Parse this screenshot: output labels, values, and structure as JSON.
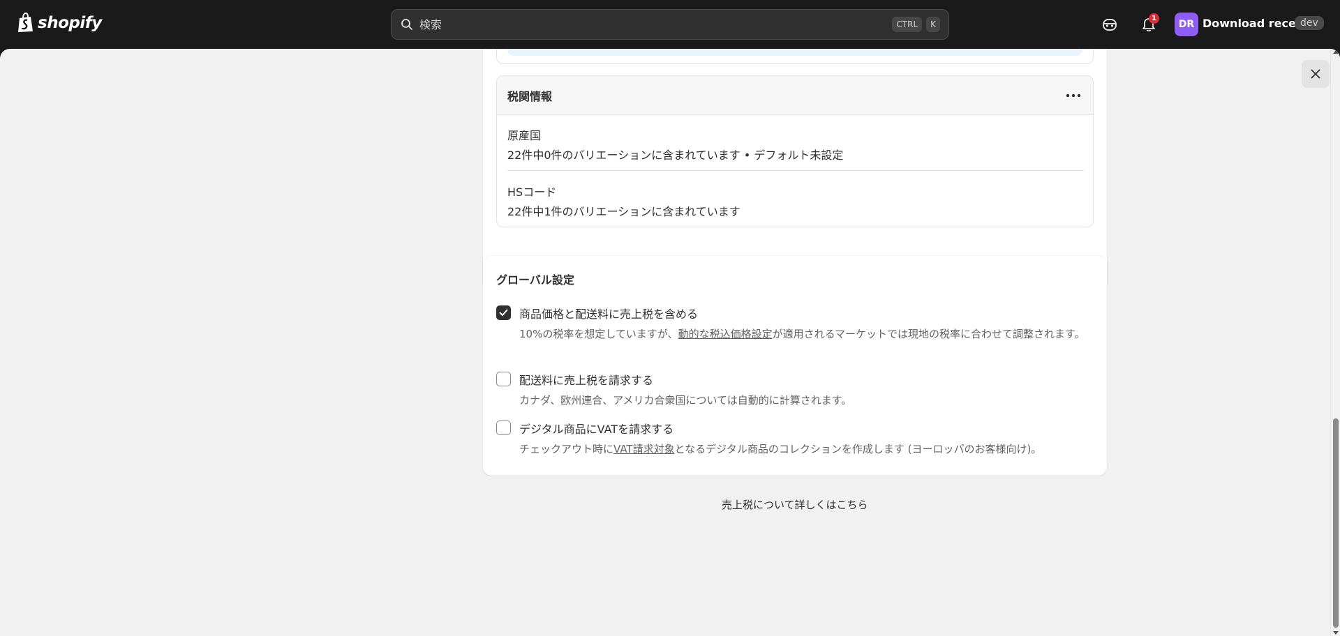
{
  "topbar": {
    "brand": "shopify",
    "search_placeholder": "検索",
    "shortcut_keys": [
      "CTRL",
      "K"
    ],
    "notification_count": "1",
    "avatar_initials": "DR",
    "store_name": "Download receipt",
    "store_badge": "dev"
  },
  "customs": {
    "title": "税関情報",
    "rows": [
      {
        "label": "原産国",
        "desc": "22件中0件のバリエーションに含まれています • デフォルト未設定"
      },
      {
        "label": "HSコード",
        "desc": "22件中1件のバリエーションに含まれています"
      }
    ]
  },
  "global": {
    "title": "グローバル設定",
    "options": [
      {
        "label": "商品価格と配送料に売上税を含める",
        "checked": true,
        "desc_before": "10%の税率を想定していますが、",
        "desc_link": "動的な税込価格設定",
        "desc_after": "が適用されるマーケットでは現地の税率に合わせて調整されます。"
      },
      {
        "label": "配送料に売上税を請求する",
        "checked": false,
        "desc": "カナダ、欧州連合、アメリカ合衆国については自動的に計算されます。"
      },
      {
        "label": "デジタル商品にVATを請求する",
        "checked": false,
        "desc_before": "チェックアウト時に",
        "desc_link": "VAT請求対象",
        "desc_after": "となるデジタル商品のコレクションを作成します (ヨーロッパのお客様向け)。"
      }
    ]
  },
  "footer_link": "売上税について詳しくはこちら"
}
